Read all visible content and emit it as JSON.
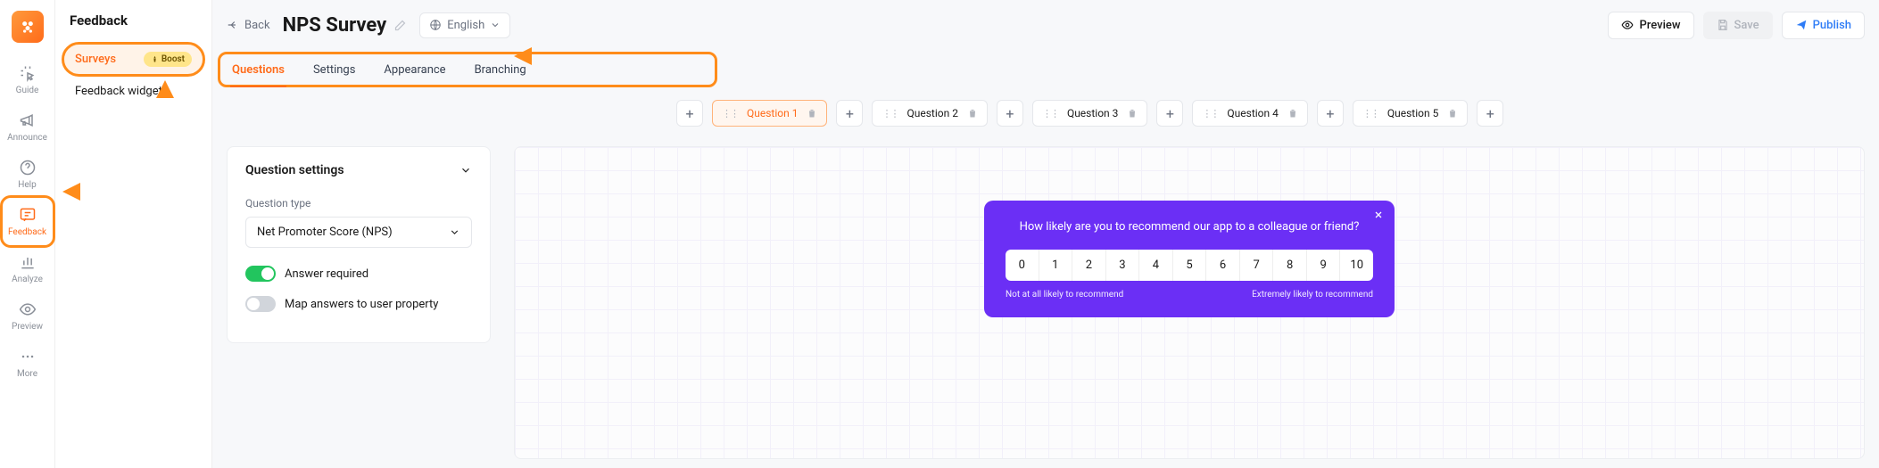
{
  "rail": {
    "items": [
      {
        "label": "Guide"
      },
      {
        "label": "Announce"
      },
      {
        "label": "Help"
      },
      {
        "label": "Feedback"
      },
      {
        "label": "Analyze"
      },
      {
        "label": "Preview"
      },
      {
        "label": "More"
      }
    ]
  },
  "sidebar": {
    "title": "Feedback",
    "items": [
      {
        "label": "Surveys",
        "boost": "Boost"
      },
      {
        "label": "Feedback widget"
      }
    ]
  },
  "header": {
    "back": "Back",
    "title": "NPS Survey",
    "language": "English",
    "preview": "Preview",
    "save": "Save",
    "publish": "Publish"
  },
  "tabs": [
    {
      "label": "Questions"
    },
    {
      "label": "Settings"
    },
    {
      "label": "Appearance"
    },
    {
      "label": "Branching"
    }
  ],
  "questions": [
    {
      "label": "Question 1"
    },
    {
      "label": "Question 2"
    },
    {
      "label": "Question 3"
    },
    {
      "label": "Question 4"
    },
    {
      "label": "Question 5"
    }
  ],
  "settings": {
    "heading": "Question settings",
    "type_label": "Question type",
    "type_value": "Net Promoter Score (NPS)",
    "answer_required": "Answer required",
    "map_property": "Map answers to user property"
  },
  "survey": {
    "question": "How likely are you to recommend our app to a colleague or friend?",
    "scale": [
      "0",
      "1",
      "2",
      "3",
      "4",
      "5",
      "6",
      "7",
      "8",
      "9",
      "10"
    ],
    "low_label": "Not at all likely to recommend",
    "high_label": "Extremely likely to recommend"
  }
}
